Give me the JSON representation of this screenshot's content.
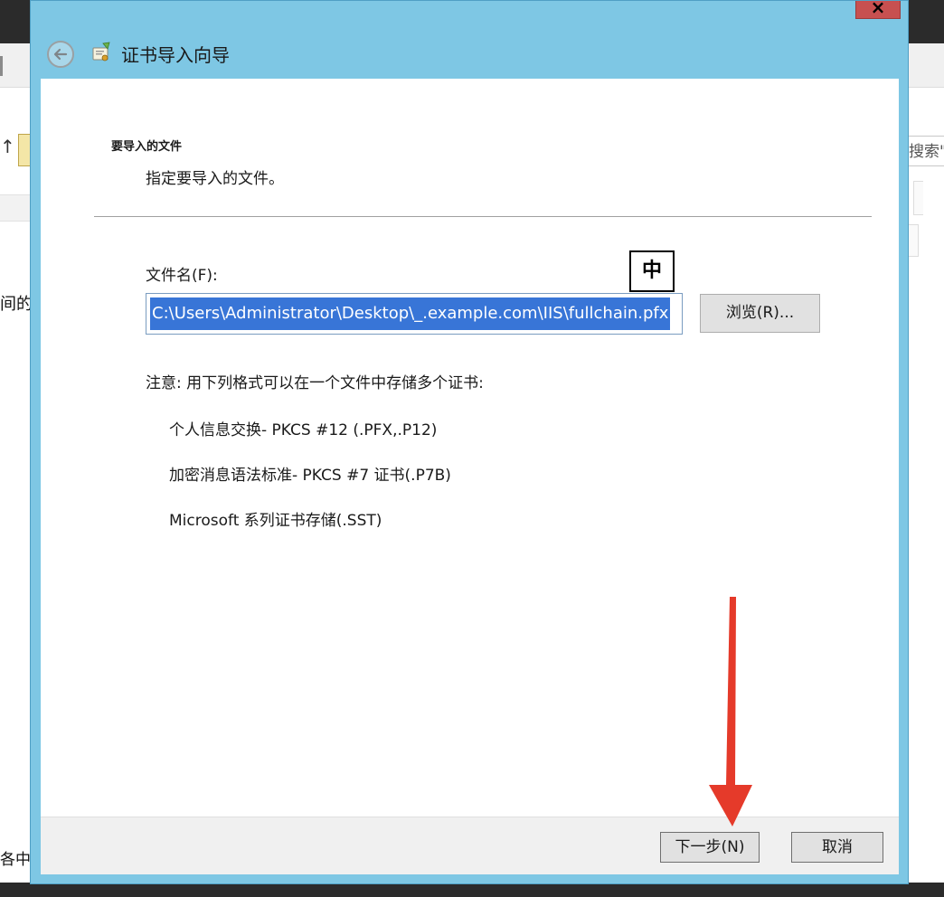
{
  "background_app": {
    "left_text": "间的f",
    "bottom_left_text": "各中",
    "search_text": "搜索\""
  },
  "dialog": {
    "title": "证书导入向导",
    "close_glyph": "×",
    "section": {
      "heading": "要导入的文件",
      "description": "指定要导入的文件。"
    },
    "file_field": {
      "label": "文件名(F):",
      "value": "C:\\Users\\Administrator\\Desktop\\_.example.com\\IIS\\fullchain.pfx"
    },
    "browse_label": "浏览(R)...",
    "ime_indicator": "中",
    "note": "注意: 用下列格式可以在一个文件中存储多个证书:",
    "formats": [
      "个人信息交换- PKCS #12 (.PFX,.P12)",
      "加密消息语法标准- PKCS #7 证书(.P7B)",
      "Microsoft 系列证书存储(.SST)"
    ],
    "footer": {
      "next_label": "下一步(N)",
      "cancel_label": "取消"
    }
  },
  "icons": {
    "back": "back-arrow-icon",
    "title": "certificate-wizard-icon",
    "annotation": "red-arrow-annotation"
  },
  "colors": {
    "dialog_frame": "#7ec7e4",
    "selection": "#3875d7",
    "annotation_arrow": "#e53a2a",
    "close_button": "#c75050"
  }
}
